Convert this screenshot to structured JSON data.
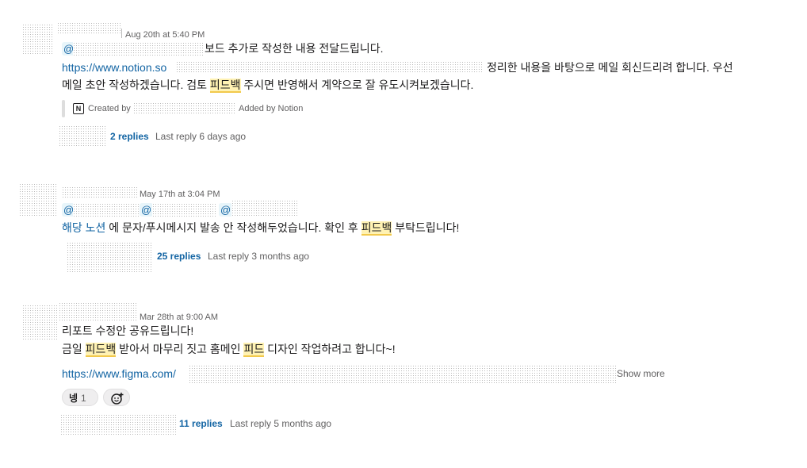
{
  "messages": [
    {
      "timestamp": "Aug 20th at 5:40 PM",
      "mention_symbol": "@",
      "line1_text": "보드 추가로 작성한 내용 전달드립니다.",
      "link": "https://www.notion.so",
      "line2_tail": "정리한 내용을 바탕으로 메일 회신드리려 합니다. 우선",
      "line3_pre": "메일 초안 작성하겠습니다. 검토 ",
      "line3_highlight": "피드백",
      "line3_post": " 주시면 반영해서 계약으로 잘 유도시켜보겠습니다.",
      "attachment": {
        "icon": "N",
        "created_by": "Created by",
        "added_by": "Added by Notion"
      },
      "thread": {
        "replies": "2 replies",
        "last_reply": "Last reply 6 days ago"
      }
    },
    {
      "timestamp": "May 17th at 3:04 PM",
      "mentions": [
        "@",
        "@",
        "@"
      ],
      "link_text": "해당 노션",
      "text_pre": " 에 문자/푸시메시지 발송 안 작성해두었습니다. 확인 후 ",
      "highlight": "피드백",
      "text_post": " 부탁드립니다!",
      "thread": {
        "replies": "25 replies",
        "last_reply": "Last reply 3 months ago"
      }
    },
    {
      "timestamp": "Mar 28th at 9:00 AM",
      "line1": "리포트 수정안 공유드립니다!",
      "line2_pre": "금일 ",
      "line2_hl1": "피드백",
      "line2_mid": " 받아서 마무리 짓고  홈메인 ",
      "line2_hl2": "피드",
      "line2_post": " 디자인 작업하려고 합니다~!",
      "link": "https://www.figma.com/",
      "show_more": "Show more",
      "reaction": {
        "emoji": "넹",
        "count": "1"
      },
      "thread": {
        "replies": "11 replies",
        "last_reply": "Last reply 5 months ago"
      }
    }
  ]
}
